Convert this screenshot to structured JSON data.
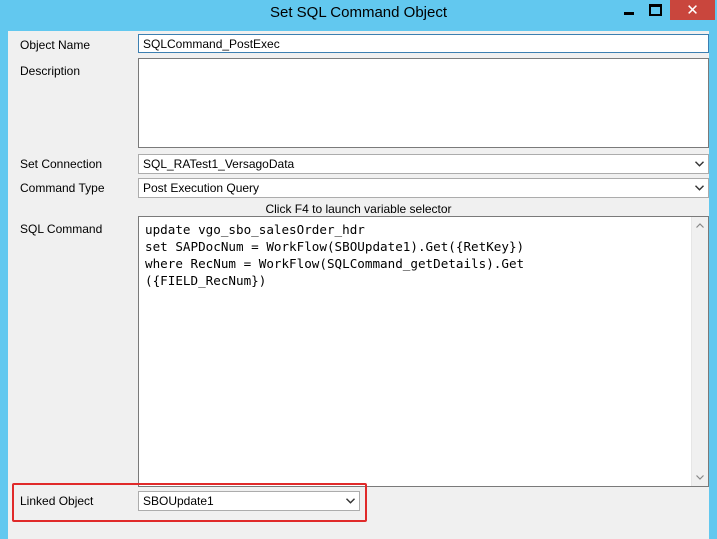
{
  "window": {
    "title": "Set SQL Command Object",
    "minimize_icon": "minimize-icon",
    "maximize_icon": "maximize-icon",
    "close_icon": "close-icon"
  },
  "form": {
    "object_name_label": "Object Name",
    "object_name_value": "SQLCommand_PostExec",
    "description_label": "Description",
    "description_value": "",
    "set_connection_label": "Set Connection",
    "set_connection_value": "SQL_RATest1_VersagoData",
    "command_type_label": "Command Type",
    "command_type_value": "Post Execution Query",
    "hint": "Click F4 to launch variable selector",
    "sql_command_label": "SQL Command",
    "sql_command_value": "update vgo_sbo_salesOrder_hdr\nset SAPDocNum = WorkFlow(SBOUpdate1).Get({RetKey})\nwhere RecNum = WorkFlow(SQLCommand_getDetails).Get\n({FIELD_RecNum})",
    "linked_object_label": "Linked Object",
    "linked_object_value": "SBOUpdate1"
  },
  "colors": {
    "titlebar": "#62c8ef",
    "close_button": "#c9463d",
    "highlight_box": "#e02a2a"
  }
}
